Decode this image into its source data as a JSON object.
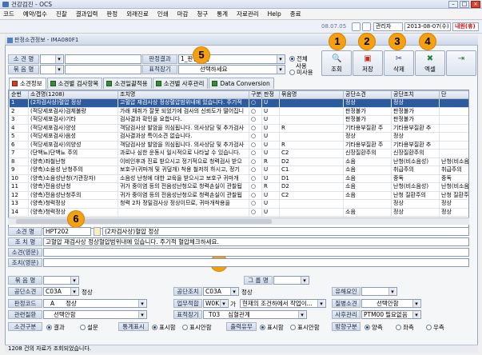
{
  "window": {
    "title": "건강검진 - OCS"
  },
  "menu": [
    "코드",
    "예약/접수",
    "진찰",
    "결과입력",
    "판정",
    "외래진료",
    "인쇄",
    "마감",
    "청구",
    "통계",
    "자료관리",
    "Help",
    "종료"
  ],
  "status": {
    "version": "08.07.05",
    "role": "관리자",
    "date": "2013-08-07(수)",
    "dept": "내원(휴)"
  },
  "form": {
    "title": "판정소견정보 - IMA080F1",
    "search": {
      "label_name": "소 견 명",
      "label_group": "묶 음 명",
      "label_result": "판정결과",
      "label_expr": "표적장기",
      "result_value": "1_판정안함",
      "expr_value": "선택하세요",
      "radios": [
        "전체",
        "사용",
        "미사용"
      ]
    },
    "toolbar": {
      "search": "조회",
      "save": "저장",
      "delete": "삭제",
      "excel": "엑셀"
    }
  },
  "badges": [
    "1",
    "2",
    "3",
    "4",
    "5",
    "6",
    "7"
  ],
  "tabs": [
    "소견정보",
    "소견별 검사항목",
    "소견일괄적용",
    "소견별 사후관리",
    "Data Conversion"
  ],
  "grid": {
    "headers": [
      "순번",
      "소견명(1208)",
      "조치명",
      "구분",
      "판정",
      "묶음명",
      "공단소견",
      "공단조치",
      "단"
    ],
    "rows": [
      [
        "1",
        "(2차검사상)혈압 정상",
        "고혈압 재검사상 정상혈압범위내에 있습니다. 주기적",
        "○",
        "U",
        "",
        "정상",
        "정상",
        ""
      ],
      [
        "2",
        "(적당세포검사)검체불량",
        "가래 채취가 잘못 되었기에 검사의 신뢰도가 떨어집니",
        "○",
        "U",
        "",
        "판정불가",
        "판정불가",
        ""
      ],
      [
        "3",
        "(적당세포검사)기타",
        "검사결과 확인을 요합니다.",
        "○",
        "U",
        "",
        "판정불가",
        "판정불가",
        ""
      ],
      [
        "4",
        "(적당세포검사)양성",
        "객담검사상 발암을 의심됩니다. 의사상담 및 추가검사",
        "○",
        "U",
        "R",
        "기타용부질환 주",
        "기타용부질환 추",
        ""
      ],
      [
        "5",
        "(적당세포검사)음성",
        "검사결과상 특이소견 없습니다.",
        "○",
        "U",
        "",
        "정상",
        "정상",
        ""
      ],
      [
        "6",
        "(적당세포검사)의양성",
        "객담검사상 발암을 의심됩니다. 의사상담 및 추가검사",
        "○",
        "U",
        "R",
        "기타용부질환 주",
        "기타용부질환 추",
        ""
      ],
      [
        "7",
        "(단백뇨)단백뇨 주의",
        "과로나 심한 운동시 일시적으로 나타날 수 있습니다.",
        "○",
        "U",
        "C2",
        "신장질환주의",
        "신장질환주의",
        ""
      ],
      [
        "8",
        "(양측)좌철난청",
        "이비인후과 진료 받으시고 정기적으로 청력검사 받으",
        "○",
        "R",
        "D2",
        "소음",
        "난청(비소음성)",
        "난청(비소음성)"
      ],
      [
        "9",
        "(양측)소음성 난청주의",
        "보호구(귀마개 및 귀덮개) 착용 철저히 하시고, 정기",
        "○",
        "U",
        "C1",
        "소음",
        "취급주의",
        "취급주의"
      ],
      [
        "10",
        "(양측)소음성난청(기관장자)",
        "소음성 난청에 대한 교육을 받으시고 보호구 귀마개",
        "○",
        "U",
        "D1",
        "소음",
        "중독",
        "중독"
      ],
      [
        "11",
        "(양측)전음성난청",
        "귀가 중이염 등의 전음성난청으로 청력손실이 관찰됩",
        "○",
        "R",
        "D2",
        "소음",
        "난청(비소음성)",
        "난청(비소음성)"
      ],
      [
        "12",
        "(양측)전음성난청주의",
        "귀가 중이염 등의 전음성난청으로 청력손실이 관찰됩",
        "○",
        "U",
        "C2",
        "소음",
        "난청 질환주의",
        "난청 질환주의"
      ],
      [
        "13",
        "(양측)청력정상",
        "청력 2차 정밀검사상 정상이므로, 귀마개착용을",
        "○",
        "U",
        "",
        "",
        "정상",
        "정상"
      ],
      [
        "14",
        "(양측)청력정상",
        "",
        "○",
        "U",
        "",
        "소음",
        "정상",
        "정상"
      ]
    ]
  },
  "detail": {
    "l_name": "소견 명",
    "code": "HPT202",
    "name": "(2차검사상)혈압 정상",
    "l_action": "조 치 명",
    "action": "고혈압 재검사상 정상혈압범위내에 있습니다. 주기적 혈압체크하세요.",
    "l_eng": "소견(영문)",
    "l_eng2": "조치(영문)",
    "l_bundle": "묶 음 명",
    "l_group": "그 룹 명",
    "l_gong_sogyeon": "공단소견",
    "gong_sogyeon_code": "C03A",
    "gong_sogyeon": "정상",
    "l_gong_jochi": "공단조치",
    "gong_jochi_code": "C03A",
    "gong_jochi": "정상",
    "l_yuhae": "유해요인",
    "l_pancode": "판정코드",
    "pancode": "A",
    "pancode_name": "정상",
    "l_work": "업무적합",
    "work_code": "W0K...",
    "work_val": "가",
    "work_text": "현재의 조건하에서 작업이...",
    "l_disease": "질병소견",
    "disease": "선택안함",
    "l_related": "관련질환",
    "related": "선택안함",
    "l_target": "표적장기",
    "target": "T03",
    "target_name": "심혈관계",
    "l_after": "사후관리",
    "after": "PTM00",
    "after_name": "필요없음",
    "l_sogyeon_div": "소견구분",
    "div_opts": [
      "결과",
      "설문"
    ],
    "l_stat": "통계표시",
    "stat_opts": [
      "표시함",
      "표시안함"
    ],
    "l_output": "출력유무",
    "output_opts": [
      "표시함",
      "표시안함"
    ],
    "l_direction": "방향구분",
    "direction_opts": [
      "양측",
      "좌측",
      "우측"
    ]
  },
  "footer": "1208 건의 자료가 조회되었습니다."
}
